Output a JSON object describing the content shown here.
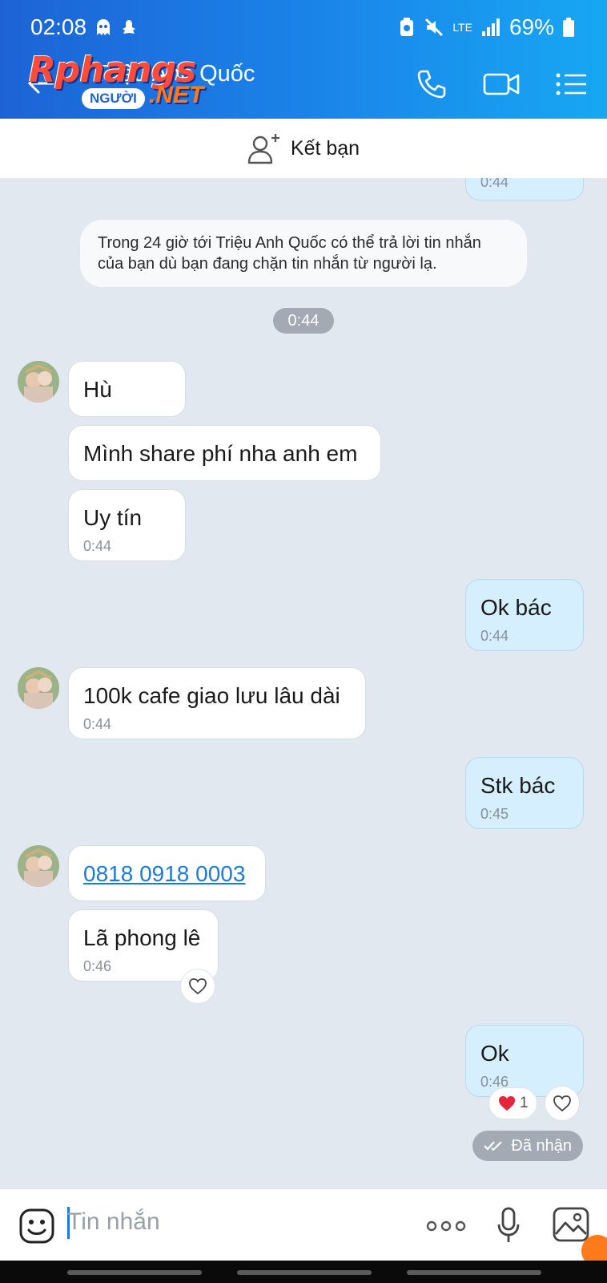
{
  "status": {
    "time": "02:08",
    "network": "LTE",
    "battery": "69%"
  },
  "header": {
    "title": "Triệu Anh Quốc",
    "logo_main": "Rphangs",
    "logo_pill": "NGƯỜI",
    "logo_suffix": ".NET"
  },
  "friend_bar": {
    "label": "Kết bạn"
  },
  "chat": {
    "prev_time": "0:44",
    "system_note": "Trong 24 giờ tới Triệu Anh Quốc có thể trả lời tin nhắn của bạn dù bạn đang chặn tin nhắn từ người lạ.",
    "time_divider": "0:44",
    "messages": [
      {
        "text": "Hù"
      },
      {
        "text": "Mình share phí nha anh em"
      },
      {
        "text": "Uy tín",
        "time": "0:44"
      },
      {
        "text": "Ok bác",
        "time": "0:44"
      },
      {
        "text": "100k cafe giao lưu lâu dài",
        "time": "0:44"
      },
      {
        "text": "Stk bác",
        "time": "0:45"
      },
      {
        "text": "0818 0918 0003"
      },
      {
        "text": "Lã phong lê",
        "time": "0:46"
      },
      {
        "text": "Ok",
        "time": "0:46"
      }
    ],
    "reaction_count": "1",
    "delivered_label": "Đã nhận"
  },
  "input": {
    "placeholder": "Tin nhắn"
  },
  "colors": {
    "brand_blue": "#1a86ea",
    "outgoing_bubble": "#d5efff",
    "link": "#1f7ad6"
  }
}
